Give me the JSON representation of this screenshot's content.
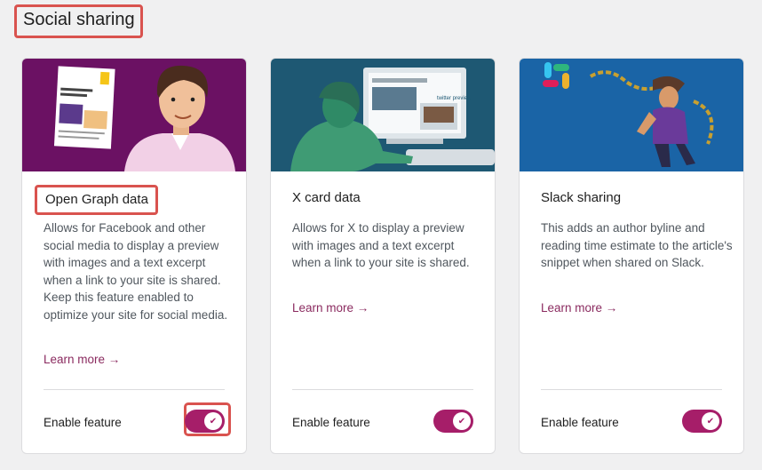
{
  "section": {
    "title": "Social sharing"
  },
  "cards": [
    {
      "title": "Open Graph data",
      "description": "Allows for Facebook and other social media to display a preview with images and a text excerpt when a link to your site is shared. Keep this feature enabled to optimize your site for social media.",
      "learn_more": "Learn more →",
      "enable_label": "Enable feature",
      "enabled": true,
      "hero_color": "#6b1163"
    },
    {
      "title": "X card data",
      "description": "Allows for X to display a preview with images and a text excerpt when a link to your site is shared.",
      "learn_more": "Learn more →",
      "enable_label": "Enable feature",
      "enabled": true,
      "hero_color": "#1e5873",
      "hero_caption": "twitter preview"
    },
    {
      "title": "Slack sharing",
      "description": "This adds an author byline and reading time estimate to the article's snippet when shared on Slack.",
      "learn_more": "Learn more →",
      "enable_label": "Enable feature",
      "enabled": true,
      "hero_color": "#1a64a6"
    }
  ],
  "colors": {
    "accent": "#a61e69",
    "link": "#8a2a5f",
    "highlight": "#d9534f"
  },
  "icons": {
    "toggle_check": "check-icon",
    "slack_logo": "slack-logo-icon"
  }
}
